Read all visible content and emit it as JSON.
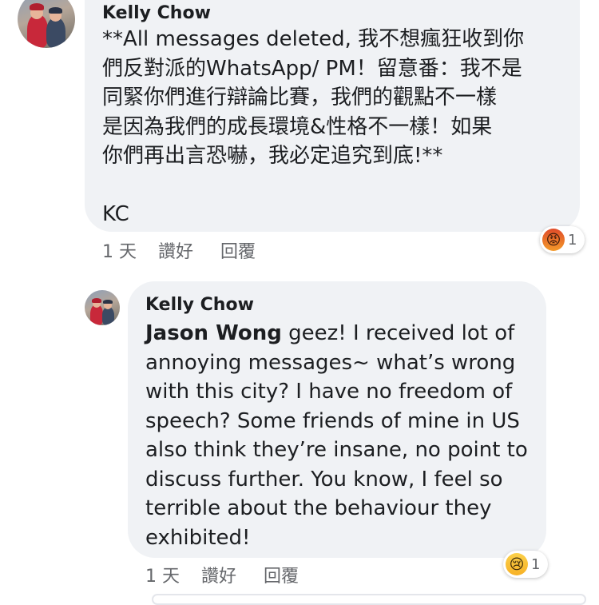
{
  "comments": [
    {
      "author": "Kelly Chow",
      "text": "**All messages deleted, 我不想瘋狂收到你\n們反對派的WhatsApp/ PM！留意番：我不是\n同緊你們進行辯論比賽，我們的觀點不一樣\n是因為我們的成長環境&性格不一樣！如果\n你們再出言恐嚇，我必定追究到底!**\n\nKC",
      "time": "1 天",
      "like_label": "讚好",
      "reply_label": "回覆",
      "reaction": {
        "type": "angry",
        "count": "1"
      }
    },
    {
      "author": "Kelly Chow",
      "mention": "Jason Wong",
      "text": " geez! I received lot of\nannoying messages~ what’s wrong\nwith this city? I have no freedom of\nspeech? Some friends of mine in US\nalso think they’re insane, no point to\ndiscuss further. You know, I feel so\nterrible about the behaviour they\nexhibited!",
      "time": "1 天",
      "like_label": "讚好",
      "reply_label": "回覆",
      "reaction": {
        "type": "sad",
        "count": "1"
      }
    }
  ],
  "colors": {
    "bubble": "#f0f2f5",
    "meta_text": "#65676b",
    "primary_text": "#1c1e21"
  }
}
